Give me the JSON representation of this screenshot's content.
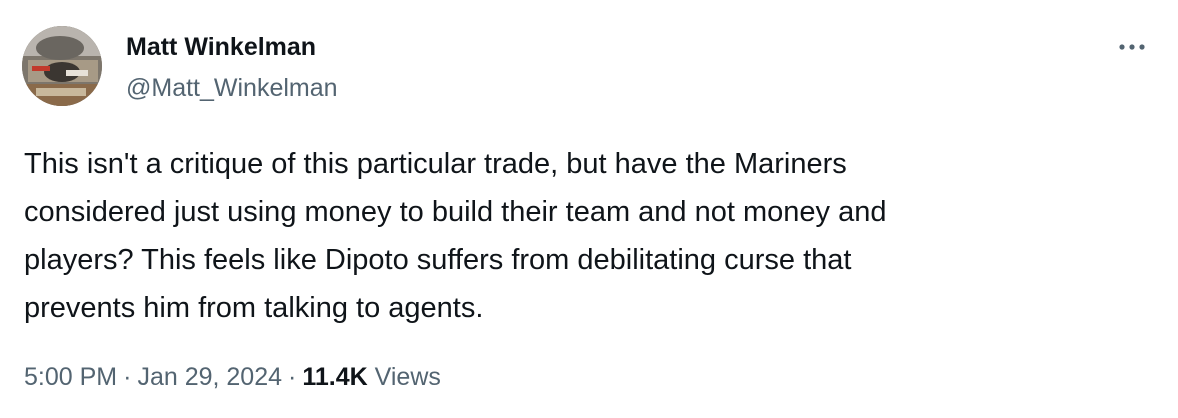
{
  "author": {
    "display_name": "Matt Winkelman",
    "handle": "@Matt_Winkelman",
    "avatar_icon": "avatar-photo"
  },
  "menu": {
    "icon": "more-horizontal-icon"
  },
  "tweet": {
    "text": "This isn't a critique of this particular trade, but have the Mariners\nconsidered just using money to build their team and not money and\nplayers? This feels like Dipoto suffers from debilitating curse that\nprevents him from talking to agents."
  },
  "meta": {
    "time": "5:00 PM",
    "separator": "·",
    "date": "Jan 29, 2024",
    "views_count": "11.4K",
    "views_label": "Views"
  },
  "colors": {
    "text_primary": "#0f1419",
    "text_secondary": "#536471",
    "background": "#ffffff"
  }
}
